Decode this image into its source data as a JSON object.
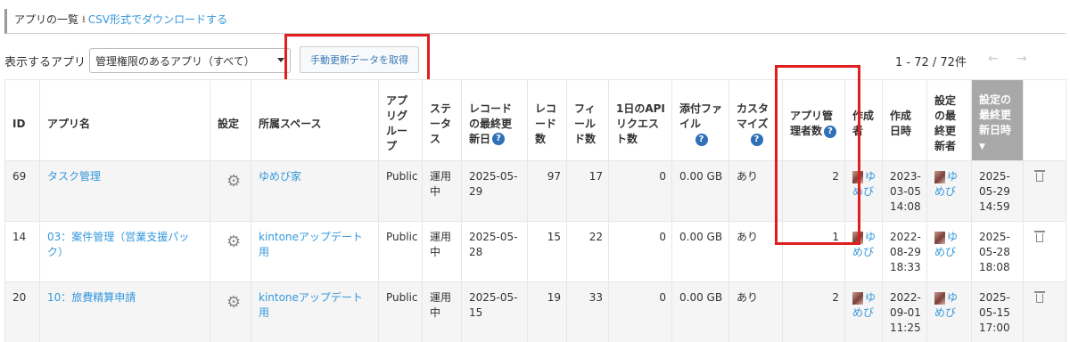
{
  "header": {
    "title": "アプリの一覧",
    "download_icon": "download-icon",
    "csv_link": "CSV形式でダウンロードする"
  },
  "toolbar": {
    "label": "表示するアプリ",
    "select_value": "管理権限のあるアプリ（すべて）",
    "update_button": "手動更新データを取得"
  },
  "pagination": {
    "range": "1 - 72 / 72件",
    "prev_icon": "arrow-left-icon",
    "next_icon": "arrow-right-icon"
  },
  "columns": {
    "id": "ID",
    "name": "アプリ名",
    "settings": "設定",
    "space": "所属スペース",
    "group": "アプリグループ",
    "status": "ステータス",
    "record_updated": "レコードの最終更新日",
    "records": "レコード数",
    "fields": "フィールド数",
    "api_requests": "1日のAPIリクエスト数",
    "attachments": "添付ファイル",
    "customize": "カスタマイズ",
    "admins": "アプリ管理者数",
    "creator": "作成者",
    "created": "作成日時",
    "settings_updater": "設定の最終更新者",
    "settings_updated": "設定の最終更新日時"
  },
  "rows": [
    {
      "id": "69",
      "name": "タスク管理",
      "space": "ゆめび家",
      "group": "Public",
      "status": "運用中",
      "record_updated": "2025-05-29",
      "records": "97",
      "fields": "17",
      "api": "0",
      "attachments": "0.00 GB",
      "customize": "あり",
      "admins": "2",
      "creator": "ゆめび",
      "created": "2023-03-05 14:08",
      "updater": "ゆめび",
      "updated": "2025-05-29 14:59"
    },
    {
      "id": "14",
      "name": "03：案件管理（営業支援パック）",
      "space": "kintoneアップデート用",
      "group": "Public",
      "status": "運用中",
      "record_updated": "2025-05-28",
      "records": "15",
      "fields": "22",
      "api": "0",
      "attachments": "0.00 GB",
      "customize": "あり",
      "admins": "1",
      "creator": "ゆめび",
      "created": "2022-08-29 18:33",
      "updater": "ゆめび",
      "updated": "2025-05-28 18:08"
    },
    {
      "id": "20",
      "name": "10：旅費精算申請",
      "space": "kintoneアップデート用",
      "group": "Public",
      "status": "運用中",
      "record_updated": "2025-05-15",
      "records": "19",
      "fields": "33",
      "api": "0",
      "attachments": "0.00 GB",
      "customize": "あり",
      "admins": "2",
      "creator": "ゆめび",
      "created": "2022-09-01 11:25",
      "updater": "ゆめび",
      "updated": "2025-05-15 17:00"
    }
  ],
  "colors": {
    "link": "#3498db",
    "highlight_box": "#e01e1e",
    "sorted_header": "#a8a8a8"
  }
}
